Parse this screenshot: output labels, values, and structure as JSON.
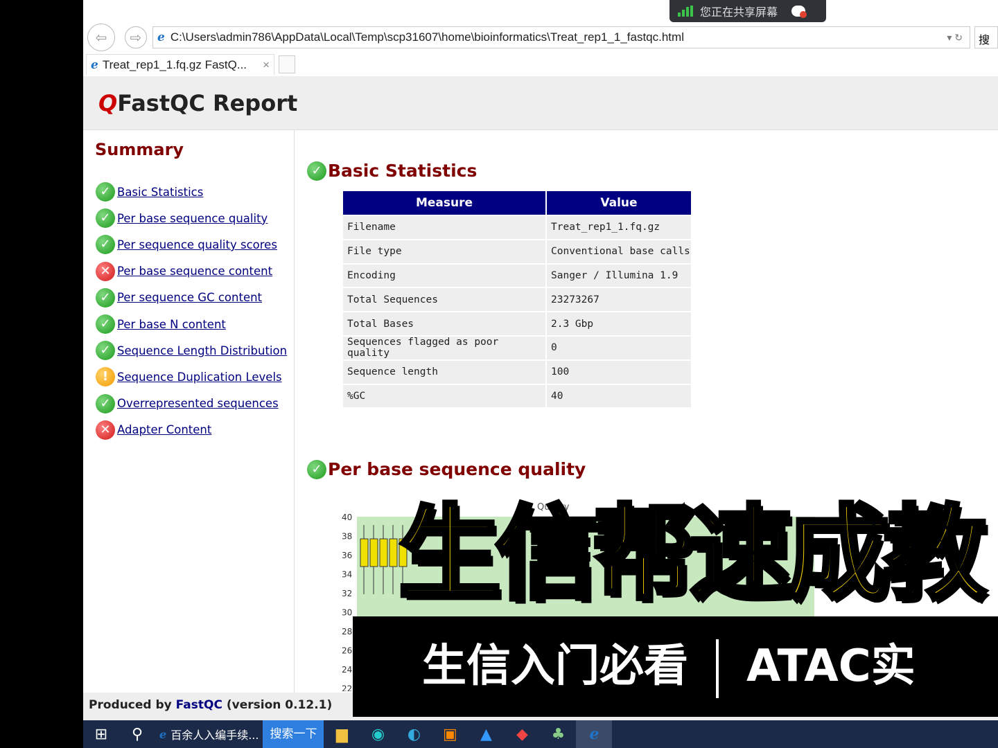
{
  "share_banner": {
    "text": "您正在共享屏幕"
  },
  "browser": {
    "address": "C:\\Users\\admin786\\AppData\\Local\\Temp\\scp31607\\home\\bioinformatics\\Treat_rep1_1_fastqc.html",
    "search_label": "搜",
    "tab_title": "Treat_rep1_1.fq.gz FastQ...",
    "tab_close": "×"
  },
  "report": {
    "title": "FastQC Report",
    "summary_title": "Summary",
    "summary": [
      {
        "label": "Basic Statistics",
        "status": "pass"
      },
      {
        "label": "Per base sequence quality",
        "status": "pass"
      },
      {
        "label": "Per sequence quality scores",
        "status": "pass"
      },
      {
        "label": "Per base sequence content",
        "status": "fail"
      },
      {
        "label": "Per sequence GC content",
        "status": "pass"
      },
      {
        "label": "Per base N content",
        "status": "pass"
      },
      {
        "label": "Sequence Length Distribution",
        "status": "pass"
      },
      {
        "label": "Sequence Duplication Levels",
        "status": "warn"
      },
      {
        "label": "Overrepresented sequences",
        "status": "pass"
      },
      {
        "label": "Adapter Content",
        "status": "fail"
      }
    ],
    "basic_stats": {
      "title": "Basic Statistics",
      "headers": [
        "Measure",
        "Value"
      ],
      "rows": [
        [
          "Filename",
          "Treat_rep1_1.fq.gz"
        ],
        [
          "File type",
          "Conventional base calls"
        ],
        [
          "Encoding",
          "Sanger / Illumina 1.9"
        ],
        [
          "Total Sequences",
          "23273267"
        ],
        [
          "Total Bases",
          "2.3 Gbp"
        ],
        [
          "Sequences flagged as poor quality",
          "0"
        ],
        [
          "Sequence length",
          "100"
        ],
        [
          "%GC",
          "40"
        ]
      ]
    },
    "per_base_quality": {
      "title": "Per base sequence quality",
      "chart_title_partial": "Quality",
      "y_ticks": [
        "40",
        "38",
        "36",
        "34",
        "32",
        "30",
        "28",
        "26",
        "24",
        "22"
      ]
    },
    "footer": {
      "produced_by": "Produced by ",
      "link": "FastQC",
      "version": " (version 0.12.1)"
    }
  },
  "taskbar": {
    "app_label": "百余人入编手续...",
    "search_button": "搜索一下"
  },
  "overlay": {
    "headline": "生信帮速成教",
    "subline_left": "生信入门必看",
    "subline_right": "ATAC实"
  },
  "colors": {
    "header_navy": "#000080",
    "section_red": "#800000",
    "overlay_yellow": "#ffd800"
  }
}
